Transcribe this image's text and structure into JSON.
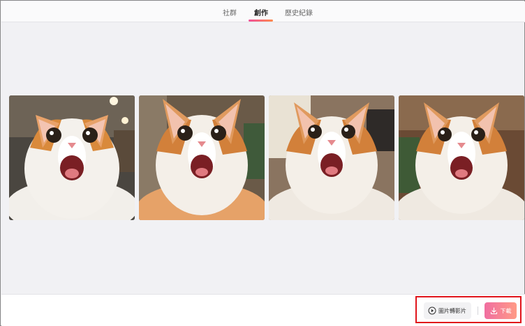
{
  "tabs": [
    {
      "label": "社群",
      "active": false
    },
    {
      "label": "創作",
      "active": true
    },
    {
      "label": "歷史紀錄",
      "active": false
    }
  ],
  "gallery": {
    "images": [
      {
        "alt": "cat-selfie-1"
      },
      {
        "alt": "cat-selfie-2"
      },
      {
        "alt": "cat-selfie-3"
      },
      {
        "alt": "cat-selfie-4"
      }
    ]
  },
  "actions": {
    "image_to_video_label": "圖片轉影片",
    "download_label": "下載"
  },
  "colors": {
    "accent_start": "#f0509a",
    "accent_end": "#ff8a4c",
    "highlight_border": "#e0141b"
  }
}
